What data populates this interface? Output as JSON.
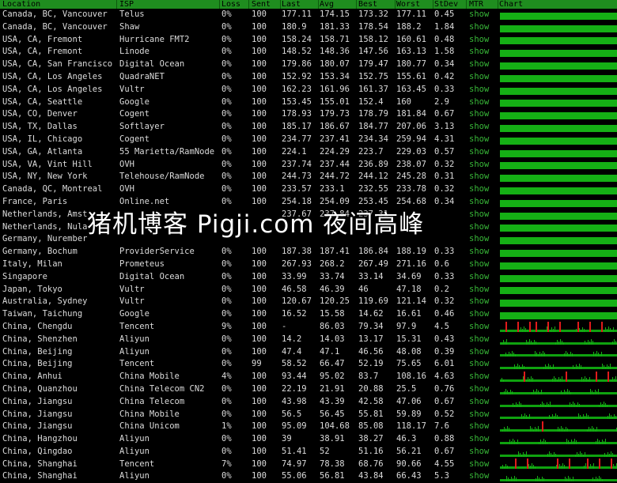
{
  "columns": [
    "Location",
    "ISP",
    "Loss",
    "Sent",
    "Last",
    "Avg",
    "Best",
    "Worst",
    "StDev",
    "MTR",
    "Chart"
  ],
  "rows": [
    {
      "location": "Canada, BC, Vancouver",
      "isp": "Telus",
      "loss": "0%",
      "sent": "100",
      "last": "177.11",
      "avg": "174.15",
      "best": "173.32",
      "worst": "177.11",
      "stdev": "0.45",
      "mtr": "show"
    },
    {
      "location": "Canada, BC, Vancouver",
      "isp": "Shaw",
      "loss": "0%",
      "sent": "100",
      "last": "180.9",
      "avg": "181.33",
      "best": "178.54",
      "worst": "188.2",
      "stdev": "1.84",
      "mtr": "show"
    },
    {
      "location": "USA, CA, Fremont",
      "isp": "Hurricane FMT2",
      "loss": "0%",
      "sent": "100",
      "last": "158.24",
      "avg": "158.71",
      "best": "158.12",
      "worst": "160.61",
      "stdev": "0.48",
      "mtr": "show"
    },
    {
      "location": "USA, CA, Fremont",
      "isp": "Linode",
      "loss": "0%",
      "sent": "100",
      "last": "148.52",
      "avg": "148.36",
      "best": "147.56",
      "worst": "163.13",
      "stdev": "1.58",
      "mtr": "show"
    },
    {
      "location": "USA, CA, San Francisco",
      "isp": "Digital Ocean",
      "loss": "0%",
      "sent": "100",
      "last": "179.86",
      "avg": "180.07",
      "best": "179.47",
      "worst": "180.77",
      "stdev": "0.34",
      "mtr": "show"
    },
    {
      "location": "USA, CA, Los Angeles",
      "isp": "QuadraNET",
      "loss": "0%",
      "sent": "100",
      "last": "152.92",
      "avg": "153.34",
      "best": "152.75",
      "worst": "155.61",
      "stdev": "0.42",
      "mtr": "show"
    },
    {
      "location": "USA, CA, Los Angeles",
      "isp": "Vultr",
      "loss": "0%",
      "sent": "100",
      "last": "162.23",
      "avg": "161.96",
      "best": "161.37",
      "worst": "163.45",
      "stdev": "0.33",
      "mtr": "show"
    },
    {
      "location": "USA, CA, Seattle",
      "isp": "Google",
      "loss": "0%",
      "sent": "100",
      "last": "153.45",
      "avg": "155.01",
      "best": "152.4",
      "worst": "160",
      "stdev": "2.9",
      "mtr": "show"
    },
    {
      "location": "USA, CO, Denver",
      "isp": "Cogent",
      "loss": "0%",
      "sent": "100",
      "last": "178.93",
      "avg": "179.73",
      "best": "178.79",
      "worst": "181.84",
      "stdev": "0.67",
      "mtr": "show"
    },
    {
      "location": "USA, TX, Dallas",
      "isp": "Softlayer",
      "loss": "0%",
      "sent": "100",
      "last": "185.17",
      "avg": "186.67",
      "best": "184.77",
      "worst": "207.06",
      "stdev": "3.13",
      "mtr": "show"
    },
    {
      "location": "USA, IL, Chicago",
      "isp": "Cogent",
      "loss": "0%",
      "sent": "100",
      "last": "234.77",
      "avg": "237.41",
      "best": "234.34",
      "worst": "259.94",
      "stdev": "4.31",
      "mtr": "show"
    },
    {
      "location": "USA, GA, Atlanta",
      "isp": "55 Marietta/RamNode",
      "loss": "0%",
      "sent": "100",
      "last": "224.1",
      "avg": "224.29",
      "best": "223.7",
      "worst": "229.03",
      "stdev": "0.57",
      "mtr": "show"
    },
    {
      "location": "USA, VA, Vint Hill",
      "isp": "OVH",
      "loss": "0%",
      "sent": "100",
      "last": "237.74",
      "avg": "237.44",
      "best": "236.89",
      "worst": "238.07",
      "stdev": "0.32",
      "mtr": "show"
    },
    {
      "location": "USA, NY, New York",
      "isp": "Telehouse/RamNode",
      "loss": "0%",
      "sent": "100",
      "last": "244.73",
      "avg": "244.72",
      "best": "244.12",
      "worst": "245.28",
      "stdev": "0.31",
      "mtr": "show"
    },
    {
      "location": "Canada, QC, Montreal",
      "isp": "OVH",
      "loss": "0%",
      "sent": "100",
      "last": "233.57",
      "avg": "233.1",
      "best": "232.55",
      "worst": "233.78",
      "stdev": "0.32",
      "mtr": "show"
    },
    {
      "location": "France, Paris",
      "isp": "Online.net",
      "loss": "0%",
      "sent": "100",
      "last": "254.18",
      "avg": "254.09",
      "best": "253.45",
      "worst": "254.68",
      "stdev": "0.34",
      "mtr": "show"
    },
    {
      "location": "Netherlands, Amst",
      "isp": "",
      "loss": "",
      "sent": "",
      "last": "237.67",
      "avg": "237.84",
      "best": "237.31",
      "worst": "",
      "stdev": "",
      "mtr": "show"
    },
    {
      "location": "Netherlands, Nula",
      "isp": "",
      "loss": "",
      "sent": "",
      "last": "",
      "avg": "",
      "best": "",
      "worst": "",
      "stdev": "",
      "mtr": "show"
    },
    {
      "location": "Germany, Nurember",
      "isp": "",
      "loss": "",
      "sent": "",
      "last": "",
      "avg": "",
      "best": "",
      "worst": "",
      "stdev": "",
      "mtr": "show"
    },
    {
      "location": "Germany, Bochum",
      "isp": "ProviderService",
      "loss": "0%",
      "sent": "100",
      "last": "187.38",
      "avg": "187.41",
      "best": "186.84",
      "worst": "188.19",
      "stdev": "0.33",
      "mtr": "show"
    },
    {
      "location": "Italy, Milan",
      "isp": "Prometeus",
      "loss": "0%",
      "sent": "100",
      "last": "267.93",
      "avg": "268.2",
      "best": "267.49",
      "worst": "271.16",
      "stdev": "0.6",
      "mtr": "show"
    },
    {
      "location": "Singapore",
      "isp": "Digital Ocean",
      "loss": "0%",
      "sent": "100",
      "last": "33.99",
      "avg": "33.74",
      "best": "33.14",
      "worst": "34.69",
      "stdev": "0.33",
      "mtr": "show"
    },
    {
      "location": "Japan, Tokyo",
      "isp": "Vultr",
      "loss": "0%",
      "sent": "100",
      "last": "46.58",
      "avg": "46.39",
      "best": "46",
      "worst": "47.18",
      "stdev": "0.2",
      "mtr": "show"
    },
    {
      "location": "Australia, Sydney",
      "isp": "Vultr",
      "loss": "0%",
      "sent": "100",
      "last": "120.67",
      "avg": "120.25",
      "best": "119.69",
      "worst": "121.14",
      "stdev": "0.32",
      "mtr": "show"
    },
    {
      "location": "Taiwan, Taichung",
      "isp": "Google",
      "loss": "0%",
      "sent": "100",
      "last": "16.52",
      "avg": "15.58",
      "best": "14.62",
      "worst": "16.61",
      "stdev": "0.46",
      "mtr": "show"
    },
    {
      "location": "China, Chengdu",
      "isp": "Tencent",
      "loss": "9%",
      "sent": "100",
      "last": "-",
      "avg": "86.03",
      "best": "79.34",
      "worst": "97.9",
      "stdev": "4.5",
      "mtr": "show"
    },
    {
      "location": "China, Shenzhen",
      "isp": "Aliyun",
      "loss": "0%",
      "sent": "100",
      "last": "14.2",
      "avg": "14.03",
      "best": "13.17",
      "worst": "15.31",
      "stdev": "0.43",
      "mtr": "show"
    },
    {
      "location": "China, Beijing",
      "isp": "Aliyun",
      "loss": "0%",
      "sent": "100",
      "last": "47.4",
      "avg": "47.1",
      "best": "46.56",
      "worst": "48.08",
      "stdev": "0.39",
      "mtr": "show"
    },
    {
      "location": "China, Beijing",
      "isp": "Tencent",
      "loss": "0%",
      "sent": "99",
      "last": "58.52",
      "avg": "66.47",
      "best": "52.19",
      "worst": "75.65",
      "stdev": "6.01",
      "mtr": "show"
    },
    {
      "location": "China, Anhui",
      "isp": "China Mobile",
      "loss": "4%",
      "sent": "100",
      "last": "93.44",
      "avg": "95.02",
      "best": "83.7",
      "worst": "108.16",
      "stdev": "4.63",
      "mtr": "show"
    },
    {
      "location": "China, Quanzhou",
      "isp": "China Telecom CN2",
      "loss": "0%",
      "sent": "100",
      "last": "22.19",
      "avg": "21.91",
      "best": "20.88",
      "worst": "25.5",
      "stdev": "0.76",
      "mtr": "show"
    },
    {
      "location": "China, Jiangsu",
      "isp": "China Telecom",
      "loss": "0%",
      "sent": "100",
      "last": "43.98",
      "avg": "43.39",
      "best": "42.58",
      "worst": "47.06",
      "stdev": "0.67",
      "mtr": "show"
    },
    {
      "location": "China, Jiangsu",
      "isp": "China Mobile",
      "loss": "0%",
      "sent": "100",
      "last": "56.5",
      "avg": "56.45",
      "best": "55.81",
      "worst": "59.89",
      "stdev": "0.52",
      "mtr": "show"
    },
    {
      "location": "China, Jiangsu",
      "isp": "China Unicom",
      "loss": "1%",
      "sent": "100",
      "last": "95.09",
      "avg": "104.68",
      "best": "85.08",
      "worst": "118.17",
      "stdev": "7.6",
      "mtr": "show"
    },
    {
      "location": "China, Hangzhou",
      "isp": "Aliyun",
      "loss": "0%",
      "sent": "100",
      "last": "39",
      "avg": "38.91",
      "best": "38.27",
      "worst": "46.3",
      "stdev": "0.88",
      "mtr": "show"
    },
    {
      "location": "China, Qingdao",
      "isp": "Aliyun",
      "loss": "0%",
      "sent": "100",
      "last": "51.41",
      "avg": "52",
      "best": "51.16",
      "worst": "56.21",
      "stdev": "0.67",
      "mtr": "show"
    },
    {
      "location": "China, Shanghai",
      "isp": "Tencent",
      "loss": "7%",
      "sent": "100",
      "last": "74.97",
      "avg": "78.38",
      "best": "68.76",
      "worst": "90.66",
      "stdev": "4.55",
      "mtr": "show"
    },
    {
      "location": "China, Shanghai",
      "isp": "Aliyun",
      "loss": "0%",
      "sent": "100",
      "last": "55.06",
      "avg": "56.81",
      "best": "43.84",
      "worst": "66.43",
      "stdev": "5.3",
      "mtr": "show"
    }
  ],
  "watermark": "猪机博客 Pigji.com 夜间高峰",
  "colors": {
    "header_bg": "#1f8d1f",
    "chart_ok": "#15b015",
    "chart_loss": "#e11b1b",
    "link": "#38b838"
  }
}
